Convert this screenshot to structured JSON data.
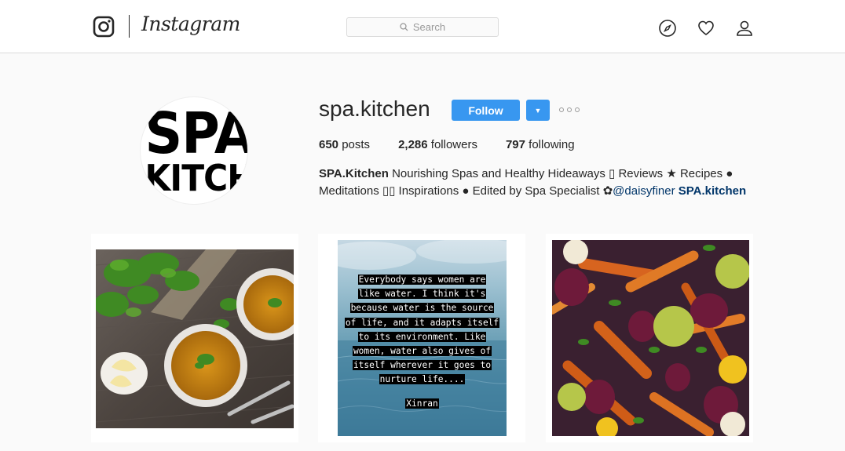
{
  "header": {
    "brand": "Instagram",
    "search_placeholder": "Search"
  },
  "profile": {
    "avatar_line1": "SPA",
    "avatar_line2": "KITCHEN",
    "username": "spa.kitchen",
    "follow_label": "Follow",
    "stats": {
      "posts_count": "650",
      "posts_label": "posts",
      "followers_count": "2,286",
      "followers_label": "followers",
      "following_count": "797",
      "following_label": "following"
    },
    "bio": {
      "name": "SPA.Kitchen",
      "line1_text": " Nourishing Spas and Healthy Hideaways ▯ Reviews ★ Recipes ●",
      "line2_text": "Meditations ▯▯ Inspirations ● Edited by Spa Specialist ✿",
      "mention": "@daisyfiner",
      "site": "SPA.kitchen"
    }
  },
  "posts": [
    {
      "alt": "soup"
    },
    {
      "quote_lines": [
        "Everybody says women are",
        "like water. I think it's",
        "because water is the source",
        "of life, and it adapts itself",
        "to its environment. Like",
        "women, water also gives of",
        "itself wherever it goes to",
        "nurture life...."
      ],
      "quote_author": "Xinran"
    },
    {
      "alt": "roasted vegetables"
    }
  ],
  "colors": {
    "accent": "#3897f0",
    "link": "#003569",
    "border": "#dbdbdb",
    "background": "#fafafa"
  }
}
